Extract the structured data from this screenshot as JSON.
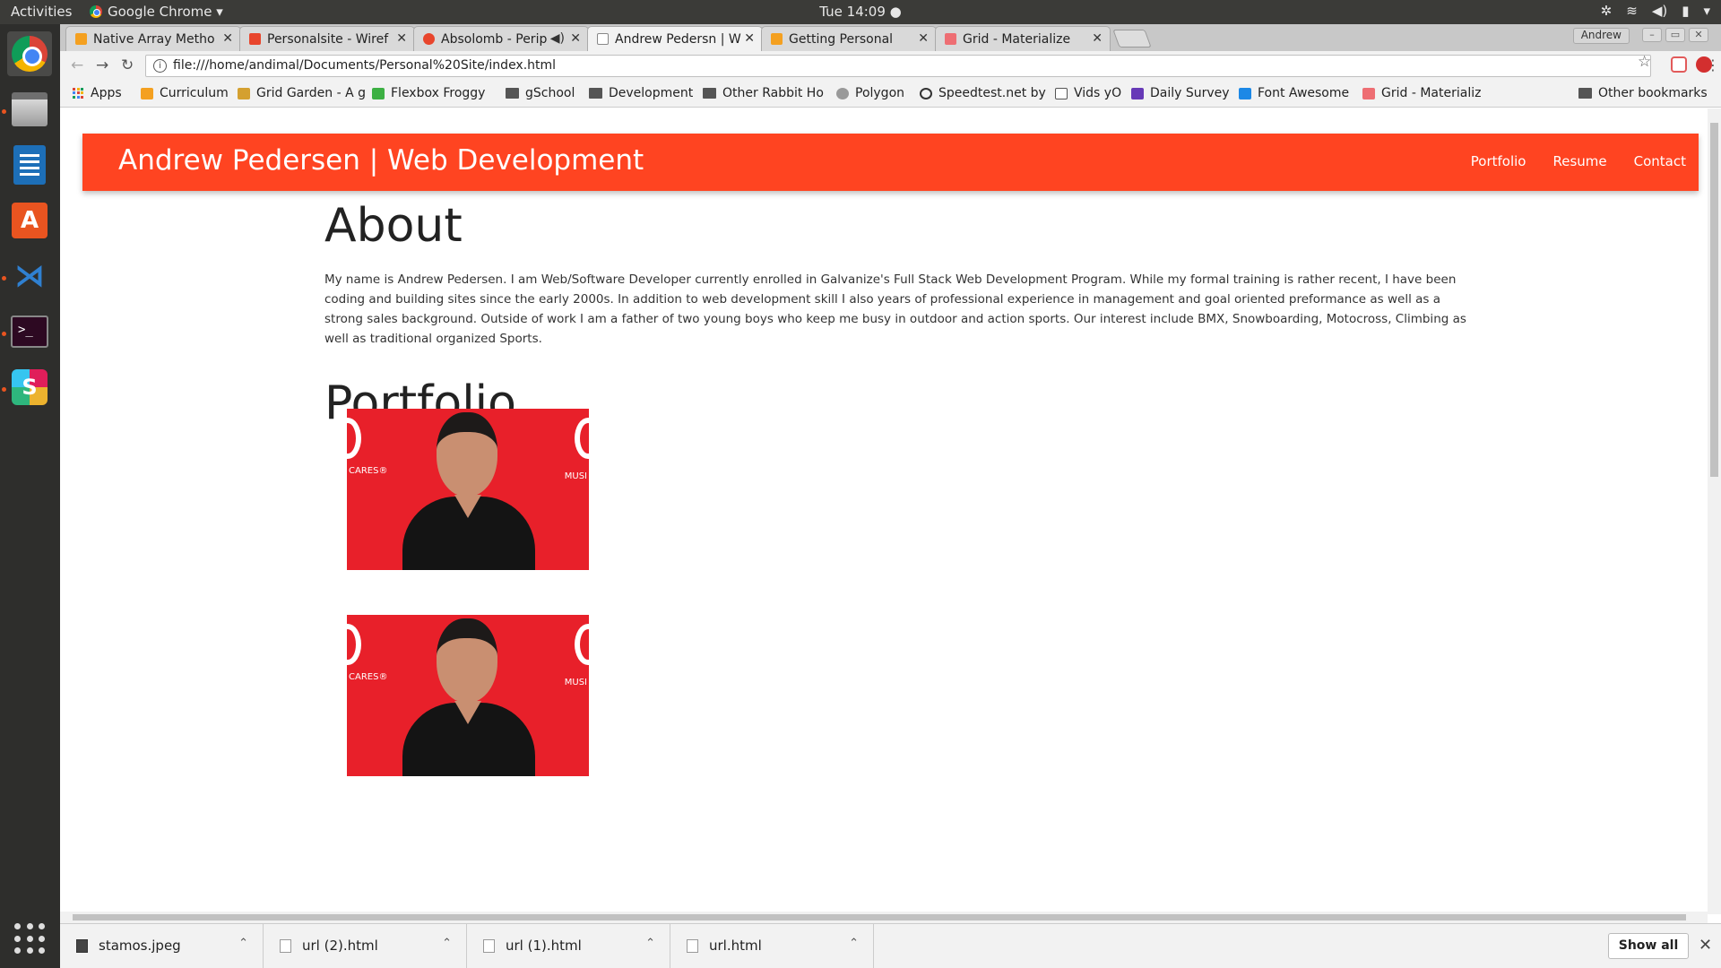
{
  "system": {
    "activities": "Activities",
    "app_menu": "Google Chrome ▾",
    "clock": "Tue 14:09 ●",
    "tray_icons": [
      "settings-icon",
      "wifi-icon",
      "volume-icon",
      "battery-icon",
      "power-menu-icon"
    ]
  },
  "launcher": [
    "chrome",
    "files",
    "writer",
    "software-center",
    "vscode",
    "terminal",
    "slack",
    "show-apps"
  ],
  "tabs": [
    {
      "title": "Native Array Metho",
      "favicon_color": "#f4a020"
    },
    {
      "title": "Personalsite - Wiref",
      "favicon_color": "#e8452c"
    },
    {
      "title": "Absolomb - Perip",
      "favicon_color": "#e8452c"
    },
    {
      "title": "Andrew Pedersn | W",
      "favicon_color": "#888888",
      "active": true
    },
    {
      "title": "Getting Personal",
      "favicon_color": "#f4a020"
    },
    {
      "title": "Grid - Materialize",
      "favicon_color": "#ee6e73"
    }
  ],
  "profile": "Andrew",
  "address": "file:///home/andimal/Documents/Personal%20Site/index.html",
  "bookmarks": [
    {
      "label": "Apps"
    },
    {
      "label": "Curriculum"
    },
    {
      "label": "Grid Garden - A g"
    },
    {
      "label": "Flexbox Froggy"
    },
    {
      "label": "gSchool"
    },
    {
      "label": "Development"
    },
    {
      "label": "Other Rabbit Ho"
    },
    {
      "label": "Polygon"
    },
    {
      "label": "Speedtest.net by"
    },
    {
      "label": "Vids yO"
    },
    {
      "label": "Daily Survey"
    },
    {
      "label": "Font Awesome"
    },
    {
      "label": "Grid - Materializ"
    },
    {
      "label": "Other bookmarks"
    }
  ],
  "site": {
    "brand": "Andrew Pedersen | Web Development",
    "nav": [
      "Portfolio",
      "Resume",
      "Contact"
    ],
    "nav_color": "#ff4421",
    "about_title": "About",
    "about_text": "My name is Andrew Pedersen. I am Web/Software Developer currently enrolled in Galvanize's Full Stack Web Development Program. While my formal training is rather recent, I have been coding and building sites since the early 2000s. In addition to web development skill I also years of professional experience in management and goal oriented preformance as well as a strong sales background. Outside of work I am a father of two young boys who keep me busy in outdoor and action sports. Our interest include BMX, Snowboarding, Motocross, Climbing as well as traditional organized Sports.",
    "portfolio_title": "Portfolio",
    "image_text_left": "CARES®",
    "image_text_right": "MUSI"
  },
  "downloads": [
    {
      "name": "stamos.jpeg"
    },
    {
      "name": "url (2).html"
    },
    {
      "name": "url (1).html"
    },
    {
      "name": "url.html"
    }
  ],
  "show_all": "Show all"
}
